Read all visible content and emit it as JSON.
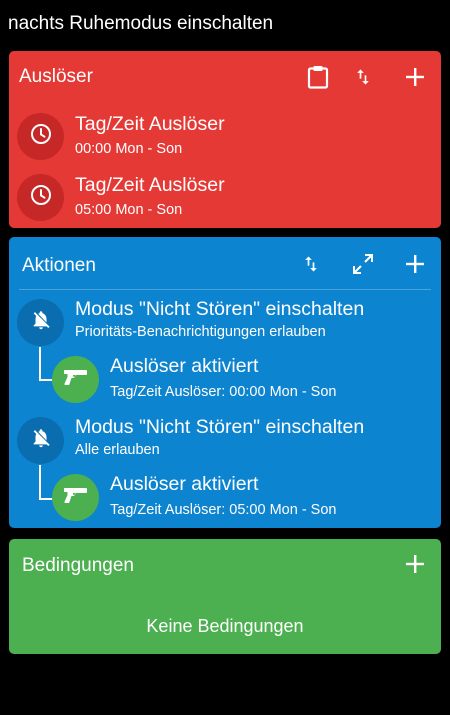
{
  "app": {
    "title": "nachts Ruhemodus einschalten"
  },
  "colors": {
    "triggers": "#e53935",
    "trigger_circle": "#c62828",
    "actions": "#0d84cf",
    "action_circle": "#0a6db0",
    "constraints": "#4caf50",
    "sub_circle": "#4caf50"
  },
  "triggers": {
    "title": "Auslöser",
    "icons": [
      "clipboard-icon",
      "sort-icon",
      "add-icon"
    ],
    "items": [
      {
        "icon": "clock-icon",
        "title": "Tag/Zeit Auslöser",
        "subtitle": "00:00 Mon - Son"
      },
      {
        "icon": "clock-icon",
        "title": "Tag/Zeit Auslöser",
        "subtitle": "05:00 Mon - Son"
      }
    ]
  },
  "actions": {
    "title": "Aktionen",
    "icons": [
      "sort-icon",
      "expand-icon",
      "add-icon"
    ],
    "items": [
      {
        "icon": "bell-off-icon",
        "title": "Modus \"Nicht Stören\" einschalten",
        "subtitle": "Prioritäts-Benachrichtigungen erlauben",
        "sub": {
          "icon": "gun-icon",
          "title": "Auslöser aktiviert",
          "subtitle": "Tag/Zeit Auslöser: 00:00 Mon - Son"
        }
      },
      {
        "icon": "bell-off-icon",
        "title": "Modus \"Nicht Stören\" einschalten",
        "subtitle": "Alle erlauben",
        "sub": {
          "icon": "gun-icon",
          "title": "Auslöser aktiviert",
          "subtitle": "Tag/Zeit Auslöser: 05:00 Mon - Son"
        }
      }
    ]
  },
  "constraints": {
    "title": "Bedingungen",
    "icons": [
      "add-icon"
    ],
    "empty_text": "Keine Bedingungen"
  }
}
